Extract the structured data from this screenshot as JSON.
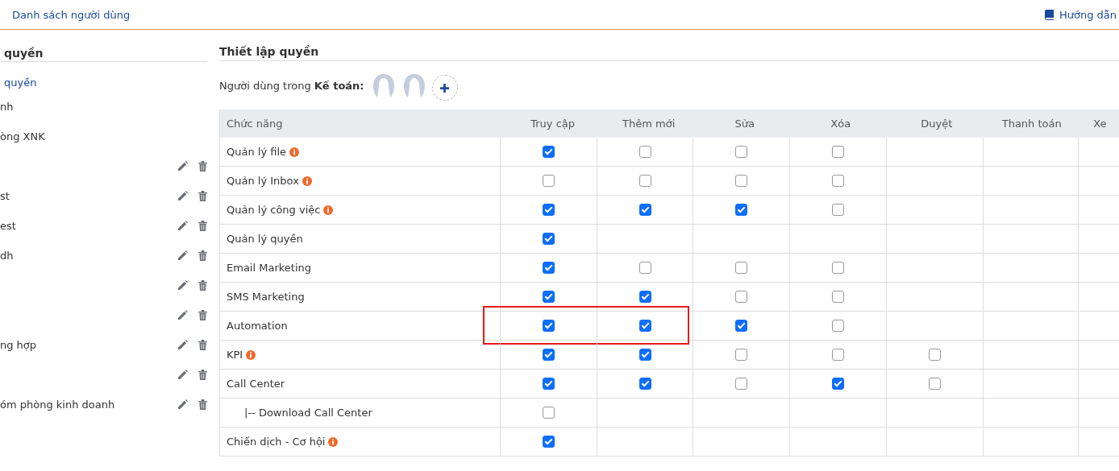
{
  "top_bar": {
    "link": "Danh sách người dùng",
    "help": "Hướng dẫn"
  },
  "sidebar": {
    "title": "quyền",
    "link": "quyền",
    "items": [
      {
        "label": "nh",
        "actions": false
      },
      {
        "label": "òng XNK",
        "actions": false
      },
      {
        "actions": true
      },
      {
        "label": "st",
        "actions": true
      },
      {
        "label": "est",
        "actions": true
      },
      {
        "label": "dh",
        "actions": true
      },
      {
        "actions": true
      },
      {
        "actions": true
      },
      {
        "label": "ng hợp",
        "actions": true
      },
      {
        "actions": true
      },
      {
        "label": "óm phòng kinh doanh",
        "actions": true
      }
    ]
  },
  "main": {
    "title": "Thiết lập quyền",
    "members_label": "Người dùng trong **Kế toán:**",
    "members": [
      {
        "kind": "avatar"
      },
      {
        "kind": "avatar"
      }
    ],
    "table": {
      "columns": [
        "Chức năng",
        "Truy cập",
        "Thêm mới",
        "Sửa",
        "Xóa",
        "Duyệt",
        "Thanh toán",
        "Xe"
      ],
      "rows": [
        {
          "name": "Quản lý file",
          "info": true,
          "cells": [
            true,
            false,
            false,
            false,
            null,
            null,
            null
          ]
        },
        {
          "name": "Quản lý Inbox",
          "info": true,
          "cells": [
            false,
            false,
            false,
            false,
            null,
            null,
            null
          ]
        },
        {
          "name": "Quản lý công việc",
          "info": true,
          "cells": [
            true,
            true,
            true,
            false,
            null,
            null,
            null
          ]
        },
        {
          "name": "Quản lý quyền",
          "info": false,
          "cells": [
            true,
            null,
            null,
            null,
            null,
            null,
            null
          ]
        },
        {
          "name": "Email Marketing",
          "info": false,
          "cells": [
            true,
            false,
            false,
            false,
            null,
            null,
            null
          ]
        },
        {
          "name": "SMS Marketing",
          "info": false,
          "cells": [
            true,
            true,
            false,
            false,
            null,
            null,
            null
          ]
        },
        {
          "name": "Automation",
          "info": false,
          "highlighted": true,
          "cells": [
            true,
            true,
            true,
            false,
            null,
            null,
            null
          ]
        },
        {
          "name": "KPI",
          "info": true,
          "cells": [
            true,
            true,
            false,
            false,
            false,
            null,
            null
          ]
        },
        {
          "name": "Call Center",
          "info": false,
          "cells": [
            true,
            true,
            false,
            true,
            false,
            null,
            null
          ],
          "children": [
            {
              "name": "|-- Download Call Center",
              "info": false,
              "cells": [
                false,
                null,
                null,
                null,
                null,
                null,
                null
              ]
            }
          ]
        },
        {
          "name": "Chiến dịch - Cơ hội",
          "info": true,
          "cells": [
            true,
            null,
            null,
            null,
            null,
            null,
            null
          ]
        }
      ]
    }
  }
}
